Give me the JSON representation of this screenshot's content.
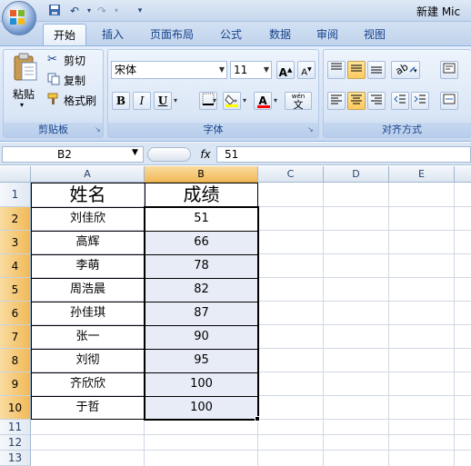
{
  "window": {
    "title": "新建 Mic"
  },
  "tabs": [
    "开始",
    "插入",
    "页面布局",
    "公式",
    "数据",
    "审阅",
    "视图"
  ],
  "clipboard": {
    "paste": "粘贴",
    "cut": "剪切",
    "copy": "复制",
    "format_painter": "格式刷",
    "label": "剪贴板"
  },
  "font": {
    "name": "宋体",
    "size": "11",
    "bold": "B",
    "italic": "I",
    "underline": "U",
    "grow": "A",
    "shrink": "A",
    "font_color": "A",
    "phonetic_top": "wén",
    "phonetic_char": "文",
    "label": "字体"
  },
  "alignment": {
    "label": "对齐方式"
  },
  "formula_bar": {
    "name_box": "B2",
    "fx": "fx",
    "value": "51"
  },
  "columns": [
    "A",
    "B",
    "C",
    "D",
    "E"
  ],
  "rows": [
    "1",
    "2",
    "3",
    "4",
    "5",
    "6",
    "7",
    "8",
    "9",
    "10",
    "11",
    "12",
    "13"
  ],
  "table": {
    "headers": [
      "姓名",
      "成绩"
    ],
    "rows": [
      [
        "刘佳欣",
        "51"
      ],
      [
        "高辉",
        "66"
      ],
      [
        "李萌",
        "78"
      ],
      [
        "周浩晨",
        "82"
      ],
      [
        "孙佳琪",
        "87"
      ],
      [
        "张一",
        "90"
      ],
      [
        "刘彻",
        "95"
      ],
      [
        "齐欣欣",
        "100"
      ],
      [
        "于哲",
        "100"
      ]
    ]
  },
  "colors": {
    "ribbon": "#d4e2f4",
    "selected_header": "#f1b957",
    "selected_range": "#e8ecf6"
  }
}
